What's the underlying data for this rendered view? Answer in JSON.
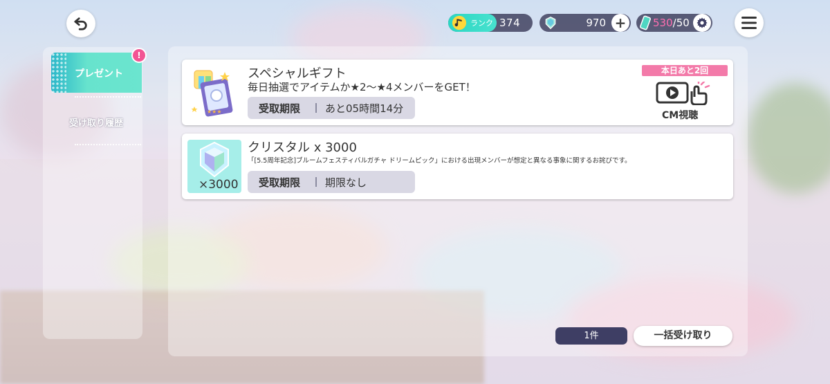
{
  "topbar": {
    "rank_label": "ランク",
    "rank_value": "374",
    "crystal_value": "970",
    "stamina_current": "530",
    "stamina_max": "/50",
    "icons": {
      "back": "back-arrow-icon",
      "menu": "hamburger-menu-icon",
      "plus": "plus-icon",
      "settings": "gear-icon"
    }
  },
  "sidebar": {
    "items": [
      {
        "label": "プレゼント",
        "active": true,
        "badge": "!"
      },
      {
        "label": "受け取り履歴",
        "active": false
      }
    ]
  },
  "presents": [
    {
      "title": "スペシャルギフト",
      "description": "毎日抽選でアイテムか★2～★4メンバーをGET！",
      "deadline_label": "受取期限",
      "deadline_value": "あと05時間14分",
      "today_badge": "本日あと2回",
      "cm_label": "CM視聴"
    },
    {
      "title": "クリスタル x 3000",
      "description": "「[5.5周年記念]ブルームフェスティバルガチャ ドリームピック」における出現メンバーが想定と異なる事象に関するお詫びです。",
      "quantity": "×3000",
      "deadline_label": "受取期限",
      "deadline_value": "期限なし"
    }
  ],
  "footer": {
    "count": "1件",
    "receive_all": "一括受け取り"
  },
  "colors": {
    "accent": "#5fe0cc",
    "pink": "#f37aa9",
    "dark": "#3e3e64"
  }
}
